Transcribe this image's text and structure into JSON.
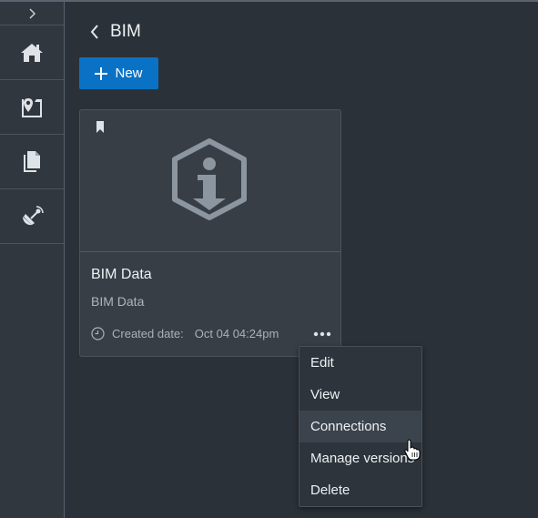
{
  "header": {
    "title": "BIM"
  },
  "toolbar": {
    "new_label": "New"
  },
  "sidebar": {
    "items": [
      {
        "icon": "home-icon"
      },
      {
        "icon": "map-pin-icon"
      },
      {
        "icon": "documents-icon"
      },
      {
        "icon": "satellite-icon"
      }
    ]
  },
  "card": {
    "title": "BIM Data",
    "subtitle": "BIM Data",
    "date_label": "Created date:",
    "date_value": "Oct 04 04:24pm"
  },
  "context_menu": {
    "items": [
      {
        "label": "Edit"
      },
      {
        "label": "View"
      },
      {
        "label": "Connections"
      },
      {
        "label": "Manage versions"
      },
      {
        "label": "Delete"
      }
    ],
    "hovered": "Connections"
  },
  "colors": {
    "accent": "#0a72c4",
    "background": "#2b3138",
    "card": "#373e46"
  }
}
